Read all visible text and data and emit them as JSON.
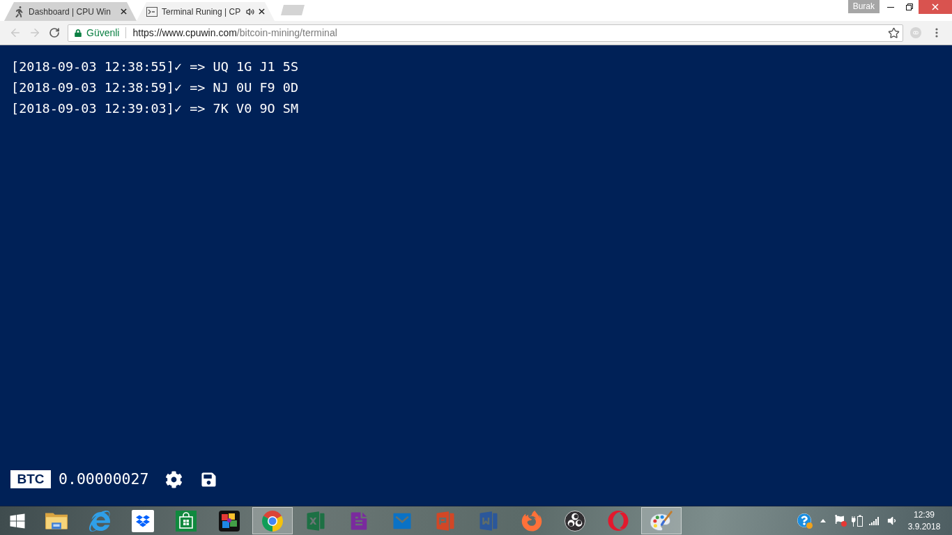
{
  "browser": {
    "tabs": [
      {
        "kind": "dashboard",
        "title": "Dashboard | CPU Win",
        "selected": false,
        "audio": false
      },
      {
        "kind": "terminal",
        "title": "Terminal Runing | CP",
        "selected": true,
        "audio": true
      }
    ],
    "profile": "Burak",
    "navigation": {
      "back_enabled": false,
      "forward_enabled": false
    },
    "address_bar": {
      "security_label": "Güvenli",
      "url_origin": "https://www.cpuwin.com",
      "url_path": "/bitcoin-mining/terminal"
    }
  },
  "terminal": {
    "lines": [
      "[2018-09-03 12:38:55]✓ => UQ 1G J1 5S",
      "[2018-09-03 12:38:59]✓ => NJ 0U F9 0D",
      "[2018-09-03 12:39:03]✓ => 7K V0 9O SM"
    ]
  },
  "wallet": {
    "currency": "BTC",
    "balance": "0.00000027"
  },
  "taskbar": {
    "apps": [
      {
        "kind": "file_explorer",
        "active": false
      },
      {
        "kind": "internet_explorer",
        "active": false
      },
      {
        "kind": "dropbox",
        "active": false
      },
      {
        "kind": "store",
        "active": false
      },
      {
        "kind": "puzzle",
        "active": false
      },
      {
        "kind": "chrome",
        "active": true
      },
      {
        "kind": "excel",
        "active": false
      },
      {
        "kind": "onenote",
        "active": false
      },
      {
        "kind": "outlook",
        "active": false
      },
      {
        "kind": "powerpoint",
        "active": false
      },
      {
        "kind": "word",
        "active": false
      },
      {
        "kind": "firefox",
        "active": false
      },
      {
        "kind": "obs",
        "active": false
      },
      {
        "kind": "opera",
        "active": false
      },
      {
        "kind": "paint",
        "active": true
      }
    ],
    "clock": {
      "time": "12:39",
      "date": "3.9.2018"
    }
  }
}
